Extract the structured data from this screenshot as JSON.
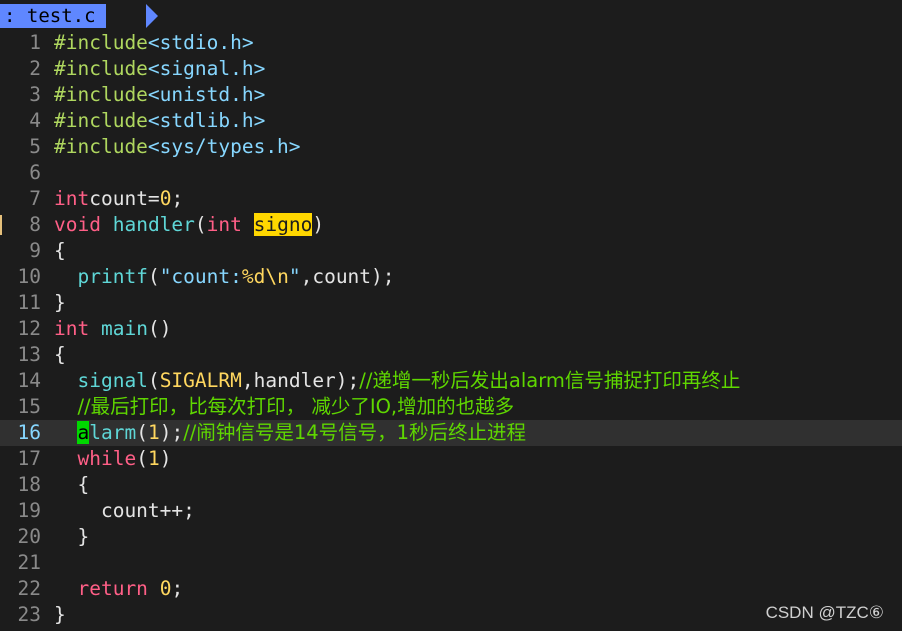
{
  "tab": {
    "label": ": test.c"
  },
  "lines": [
    {
      "n": "1",
      "parts": [
        [
          "pp",
          "#include"
        ],
        [
          "str",
          "<stdio.h>"
        ]
      ]
    },
    {
      "n": "2",
      "parts": [
        [
          "pp",
          "#include"
        ],
        [
          "str",
          "<signal.h>"
        ]
      ]
    },
    {
      "n": "3",
      "parts": [
        [
          "pp",
          "#include"
        ],
        [
          "str",
          "<unistd.h>"
        ]
      ]
    },
    {
      "n": "4",
      "parts": [
        [
          "pp",
          "#include"
        ],
        [
          "str",
          "<stdlib.h>"
        ]
      ]
    },
    {
      "n": "5",
      "parts": [
        [
          "pp",
          "#include"
        ],
        [
          "str",
          "<sys/types.h>"
        ]
      ]
    },
    {
      "n": "6",
      "parts": []
    },
    {
      "n": "7",
      "parts": [
        [
          "kw",
          "int"
        ],
        [
          "",
          "count="
        ],
        [
          "num",
          "0"
        ],
        [
          "",
          ";"
        ]
      ]
    },
    {
      "n": "8",
      "marker": true,
      "parts": [
        [
          "kw",
          "void"
        ],
        [
          "",
          " "
        ],
        [
          "fn",
          "handler"
        ],
        [
          "",
          "("
        ],
        [
          "kw",
          "int"
        ],
        [
          "",
          " "
        ],
        [
          "hl",
          "signo"
        ],
        [
          "",
          ")"
        ]
      ]
    },
    {
      "n": "9",
      "parts": [
        [
          "",
          "{"
        ]
      ]
    },
    {
      "n": "10",
      "parts": [
        [
          "",
          "  "
        ],
        [
          "fn",
          "printf"
        ],
        [
          "",
          "("
        ],
        [
          "str",
          "\"count:"
        ],
        [
          "num",
          "%d\\n"
        ],
        [
          "str",
          "\""
        ],
        [
          "",
          ",count);"
        ]
      ]
    },
    {
      "n": "11",
      "parts": [
        [
          "",
          "}"
        ]
      ]
    },
    {
      "n": "12",
      "parts": [
        [
          "kw",
          "int"
        ],
        [
          "",
          " "
        ],
        [
          "fn",
          "main"
        ],
        [
          "",
          "()"
        ]
      ]
    },
    {
      "n": "13",
      "parts": [
        [
          "",
          "{"
        ]
      ]
    },
    {
      "n": "14",
      "parts": [
        [
          "",
          "  "
        ],
        [
          "fn",
          "signal"
        ],
        [
          "",
          "("
        ],
        [
          "const",
          "SIGALRM"
        ],
        [
          "",
          ",handler);"
        ],
        [
          "cmt",
          "//递增一秒后发出alarm信号捕捉打印再终止"
        ]
      ]
    },
    {
      "n": "15",
      "parts": [
        [
          "",
          "  "
        ],
        [
          "cmt",
          "//最后打印，比每次打印， 减少了IO,增加的也越多"
        ]
      ]
    },
    {
      "n": "16",
      "current": true,
      "parts": [
        [
          "",
          "  "
        ],
        [
          "cursor",
          "a"
        ],
        [
          "fn",
          "larm"
        ],
        [
          "",
          "("
        ],
        [
          "num",
          "1"
        ],
        [
          "",
          ");"
        ],
        [
          "cmt",
          "//闹钟信号是14号信号，1秒后终止进程"
        ]
      ]
    },
    {
      "n": "17",
      "parts": [
        [
          "",
          "  "
        ],
        [
          "kw",
          "while"
        ],
        [
          "",
          "("
        ],
        [
          "num",
          "1"
        ],
        [
          "",
          ")"
        ]
      ]
    },
    {
      "n": "18",
      "parts": [
        [
          "",
          "  {"
        ]
      ]
    },
    {
      "n": "19",
      "parts": [
        [
          "",
          "    count++;"
        ]
      ]
    },
    {
      "n": "20",
      "parts": [
        [
          "",
          "  }"
        ]
      ]
    },
    {
      "n": "21",
      "parts": []
    },
    {
      "n": "22",
      "parts": [
        [
          "",
          "  "
        ],
        [
          "kw",
          "return"
        ],
        [
          "",
          " "
        ],
        [
          "num",
          "0"
        ],
        [
          "",
          ";"
        ]
      ]
    },
    {
      "n": "23",
      "parts": [
        [
          "",
          "}"
        ]
      ]
    }
  ],
  "watermark": "CSDN @TZC⑥"
}
